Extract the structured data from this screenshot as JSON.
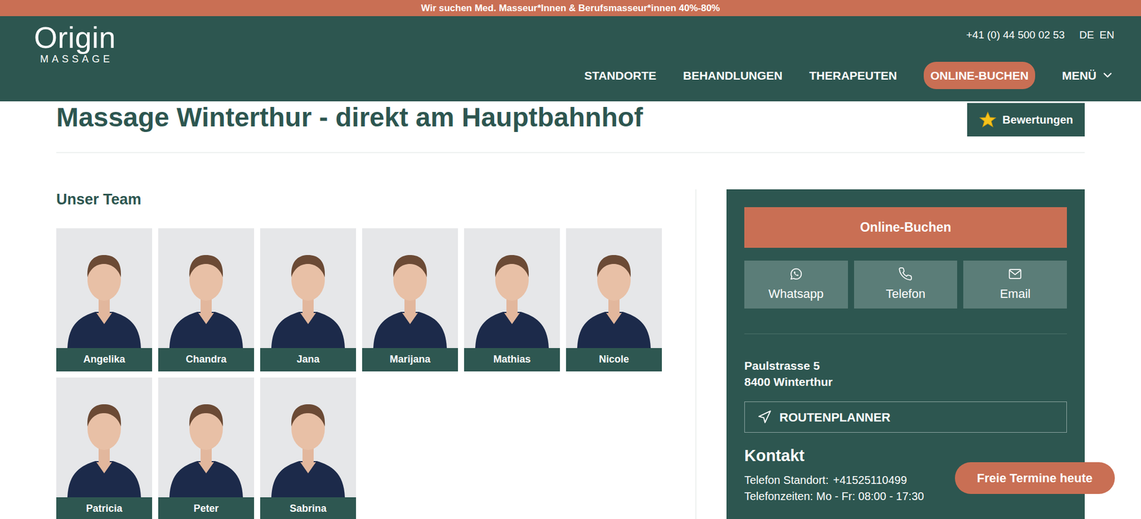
{
  "banner": "Wir suchen Med. Masseur*Innen & Berufsmasseur*innen 40%-80%",
  "header": {
    "logo": {
      "title": "Origin",
      "subtitle": "MASSAGE"
    },
    "phone": "+41 (0) 44 500 02 53",
    "languages": [
      "DE",
      "EN"
    ],
    "nav": [
      {
        "label": "STANDORTE",
        "kind": "link"
      },
      {
        "label": "BEHANDLUNGEN",
        "kind": "link"
      },
      {
        "label": "THERAPEUTEN",
        "kind": "link"
      },
      {
        "label": "ONLINE-BUCHEN",
        "kind": "pill"
      },
      {
        "label": "MENÜ",
        "kind": "dropdown"
      }
    ]
  },
  "page": {
    "title": "Massage Winterthur - direkt am Hauptbahnhof",
    "reviews_button": "Bewertungen"
  },
  "team": {
    "heading": "Unser Team",
    "members": [
      "Angelika",
      "Chandra",
      "Jana",
      "Marijana",
      "Mathias",
      "Nicole",
      "Patricia",
      "Peter",
      "Sabrina"
    ]
  },
  "sidebar": {
    "book_button": "Online-Buchen",
    "contact_buttons": [
      {
        "label": "Whatsapp",
        "kind": "whatsapp"
      },
      {
        "label": "Telefon",
        "kind": "phone"
      },
      {
        "label": "Email",
        "kind": "email"
      }
    ],
    "address": [
      "Paulstrasse 5",
      "8400 Winterthur"
    ],
    "route_button": "ROUTENPLANNER",
    "contact_heading": "Kontakt",
    "phone_label": "Telefon Standort:",
    "phone_number": "+41525110499",
    "hours": "Telefonzeiten: Mo - Fr: 08:00 - 17:30"
  },
  "floating_button": "Freie Termine heute"
}
